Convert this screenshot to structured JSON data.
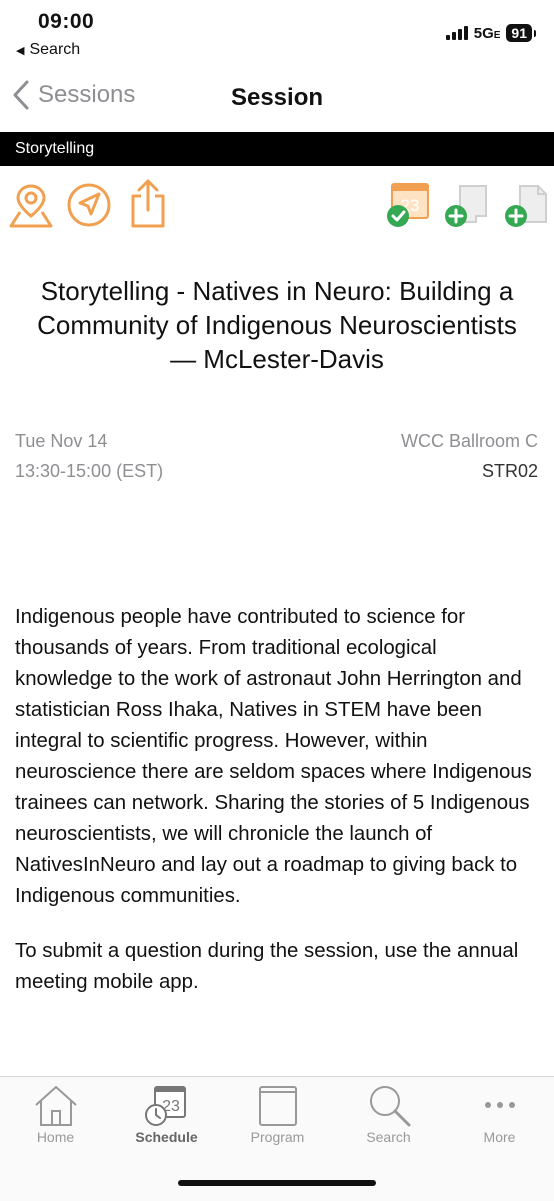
{
  "status": {
    "time": "09:00",
    "back_label": "Search",
    "network": "5G",
    "network_sub": "E",
    "battery": "91"
  },
  "nav": {
    "back_label": "Sessions",
    "title": "Session"
  },
  "track": "Storytelling",
  "calendar_day": "23",
  "session": {
    "title": "Storytelling - Natives in Neuro: Building a Community of Indigenous Neuroscientists — McLester-Davis",
    "date": "Tue Nov 14",
    "time": "13:30-15:00 (EST)",
    "room": "WCC Ballroom C",
    "code": "STR02"
  },
  "description": {
    "paragraph1": "Indigenous people have contributed to science for thousands of years. From traditional ecological knowledge to the work of astronaut John Herrington and statistician Ross Ihaka, Natives in STEM have been integral to scientific progress. However, within neuroscience there are seldom spaces where Indigenous trainees can network. Sharing the stories of 5 Indigenous neuroscientists, we will chronicle the launch of NativesInNeuro and lay out a roadmap to giving back to Indigenous communities.",
    "paragraph2": "To submit a question during the session, use the annual meeting mobile app."
  },
  "tabs": [
    {
      "label": "Home",
      "icon": "home-icon"
    },
    {
      "label": "Schedule",
      "icon": "calendar-clock-icon",
      "active": true
    },
    {
      "label": "Program",
      "icon": "book-icon"
    },
    {
      "label": "Search",
      "icon": "magnifier-icon"
    },
    {
      "label": "More",
      "icon": "ellipsis-icon"
    }
  ],
  "colors": {
    "accent": "#f0a050",
    "check_green": "#34a853",
    "nav_gray": "#8e8e93",
    "track_bar": "#000000"
  }
}
